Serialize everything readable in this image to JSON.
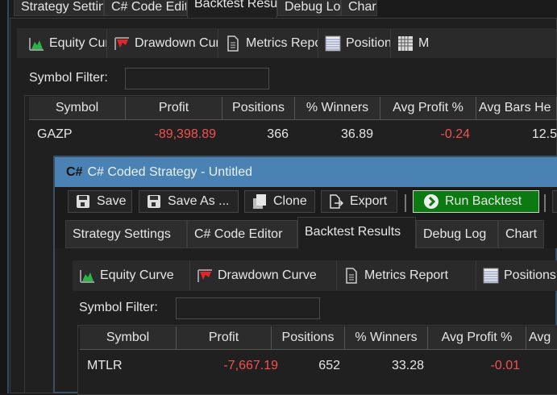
{
  "back_window": {
    "tabs": [
      "Strategy Settings",
      "C# Code Editor",
      "Backtest Results",
      "Debug Log",
      "Chart"
    ],
    "subtabs": [
      "Equity Curve",
      "Drawdown Curve",
      "Metrics Report",
      "Positions",
      "M"
    ],
    "symbol_filter_label": "Symbol Filter:",
    "symbol_filter_value": "",
    "columns": [
      "Symbol",
      "Profit",
      "Positions",
      "% Winners",
      "Avg Profit %",
      "Avg Bars He"
    ],
    "row": {
      "symbol": "GAZP",
      "profit": "-89,398.89",
      "positions": "366",
      "winners": "36.89",
      "avg_profit": "-0.24",
      "avg_bars": "12.5"
    }
  },
  "front_window": {
    "title": "C# Coded Strategy - Untitled",
    "title_icon_text": "C#",
    "toolbar": {
      "save": "Save",
      "save_as": "Save As ...",
      "clone": "Clone",
      "export": "Export",
      "run": "Run Backtest"
    },
    "tabs": [
      "Strategy Settings",
      "C# Code Editor",
      "Backtest Results",
      "Debug Log",
      "Chart"
    ],
    "subtabs": [
      "Equity Curve",
      "Drawdown Curve",
      "Metrics Report",
      "Positions"
    ],
    "symbol_filter_label": "Symbol Filter:",
    "symbol_filter_value": "",
    "columns": [
      "Symbol",
      "Profit",
      "Positions",
      "% Winners",
      "Avg Profit %",
      "Avg"
    ],
    "row": {
      "symbol": "MTLR",
      "profit": "-7,667.19",
      "positions": "652",
      "winners": "33.28",
      "avg_profit": "-0.01"
    }
  },
  "colors": {
    "title_bar": "#4a82b4",
    "run_button": "#0b7a10",
    "negative": "#ef5350"
  }
}
